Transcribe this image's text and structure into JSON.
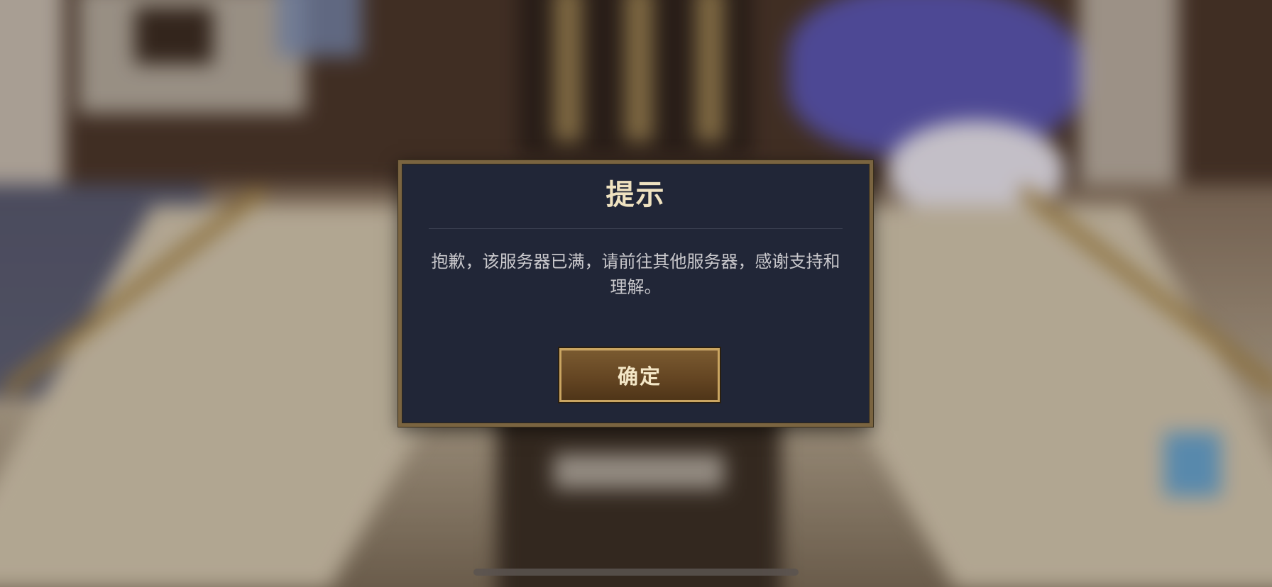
{
  "dialog": {
    "title": "提示",
    "message": "抱歉，该服务器已满，请前往其他服务器，感谢支持和理解。",
    "confirm_label": "确定"
  },
  "colors": {
    "dialog_background": "#212637",
    "dialog_border": "#7a6440",
    "title_text": "#efe2c0",
    "message_text": "#c9c8cc",
    "button_border": "#caa561",
    "button_fill": "#654623"
  }
}
